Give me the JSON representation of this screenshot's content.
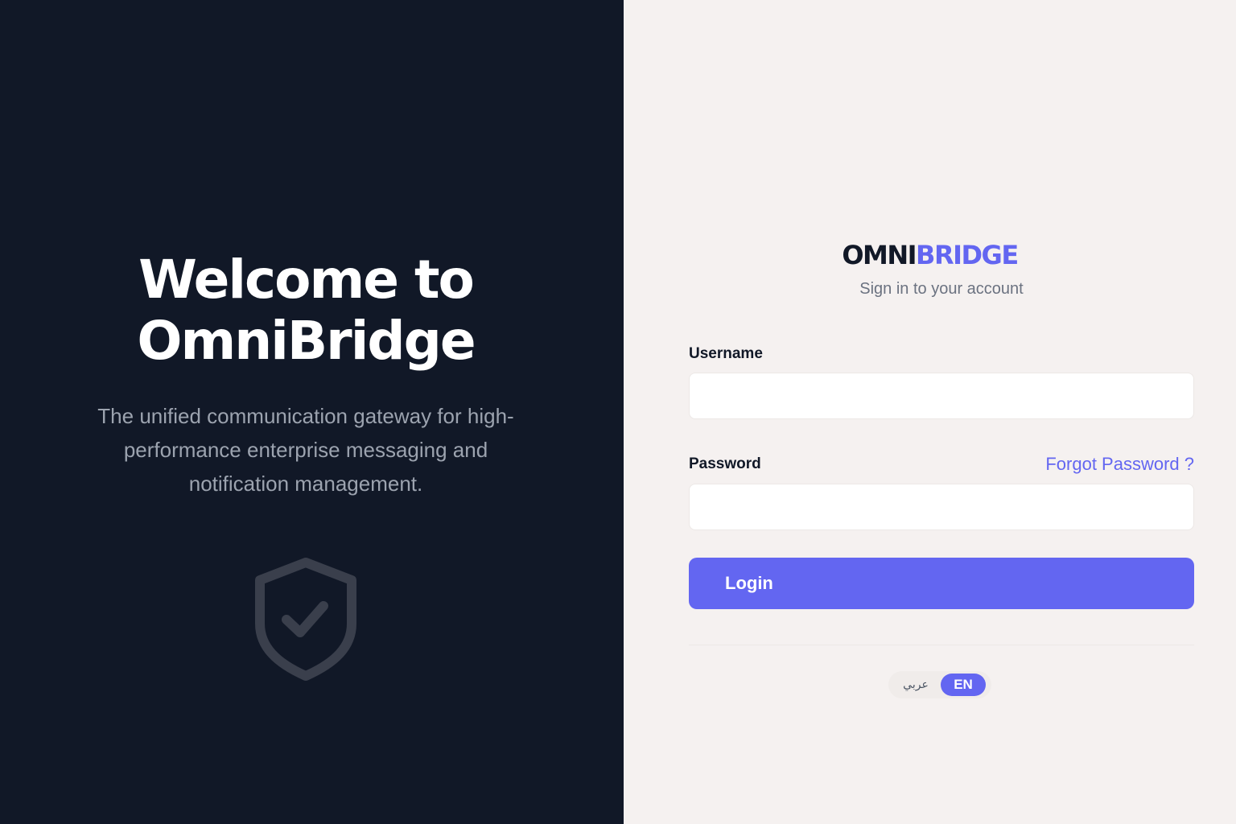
{
  "hero": {
    "title_line1": "Welcome to",
    "title_line2": "OmniBridge",
    "subtitle": "The unified communication gateway for high-performance enterprise messaging and notification management.",
    "icon": "shield-check-icon"
  },
  "brand": {
    "part1": "OMNI",
    "part2": "BRIDGE",
    "subtitle": "Sign in to your account"
  },
  "form": {
    "username_label": "Username",
    "username_value": "",
    "password_label": "Password",
    "password_value": "",
    "forgot_label": "Forgot Password ?",
    "login_label": "Login"
  },
  "language": {
    "arabic_label": "عربي",
    "english_label": "EN",
    "selected": "EN"
  },
  "colors": {
    "accent": "#6366f1",
    "dark_panel": "#111827",
    "light_panel": "#f5f1f0"
  }
}
